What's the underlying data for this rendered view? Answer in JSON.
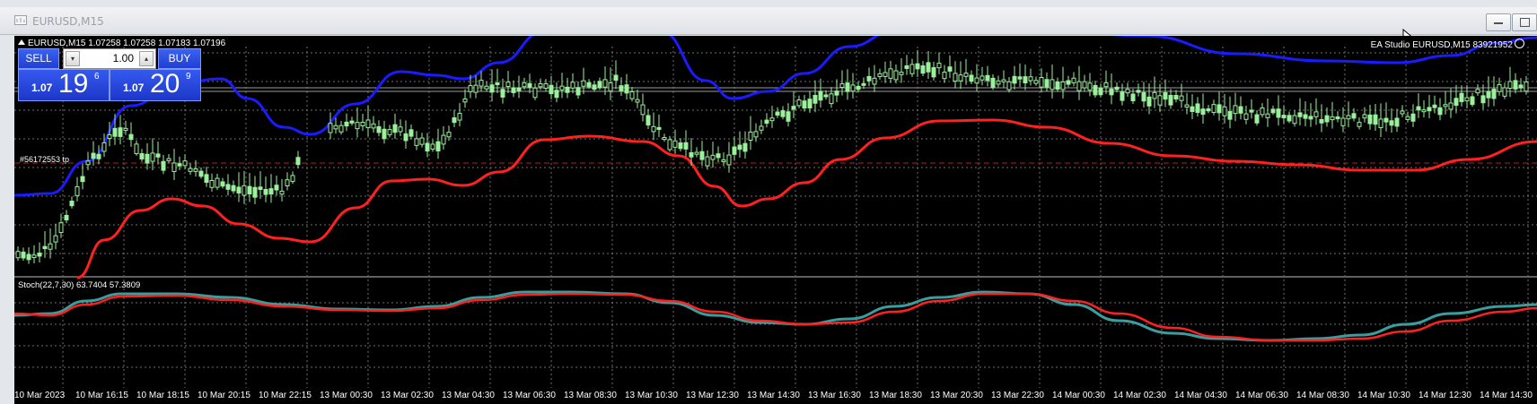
{
  "window": {
    "title": "EURUSD,M15",
    "minimize_icon": "minimize-icon",
    "maximize_icon": "maximize-icon"
  },
  "chart": {
    "info": "EURUSD,M15  1.07258 1.07258 1.07183 1.07196",
    "ea_label": "EA Studio EURUSD,M15 83921952",
    "order_label": "#56172553 tp",
    "stoch_label": "Stoch(22,7,30) 63.7404 57.3809",
    "colors": {
      "background": "#000000",
      "grid": "#8a8a8a",
      "bull": "#9bf09b",
      "upper_band": "#1b1bff",
      "lower_band": "#ff2020",
      "stoch_main": "#3b9e9e",
      "stoch_signal": "#ff2020"
    }
  },
  "trade_panel": {
    "sell_label": "SELL",
    "buy_label": "BUY",
    "lot": "1.00",
    "bid_prefix": "1.07",
    "bid_big": "19",
    "bid_sup": "6",
    "ask_prefix": "1.07",
    "ask_big": "20",
    "ask_sup": "9"
  },
  "time_axis": [
    "10 Mar 2023",
    "10 Mar 16:15",
    "10 Mar 18:15",
    "10 Mar 20:15",
    "10 Mar 22:15",
    "13 Mar 00:30",
    "13 Mar 02:30",
    "13 Mar 04:30",
    "13 Mar 06:30",
    "13 Mar 08:30",
    "13 Mar 10:30",
    "13 Mar 12:30",
    "13 Mar 14:30",
    "13 Mar 16:30",
    "13 Mar 18:30",
    "13 Mar 20:30",
    "13 Mar 22:30",
    "14 Mar 00:30",
    "14 Mar 02:30",
    "14 Mar 04:30",
    "14 Mar 06:30",
    "14 Mar 08:30",
    "14 Mar 10:30",
    "14 Mar 12:30",
    "14 Mar 14:30"
  ]
}
